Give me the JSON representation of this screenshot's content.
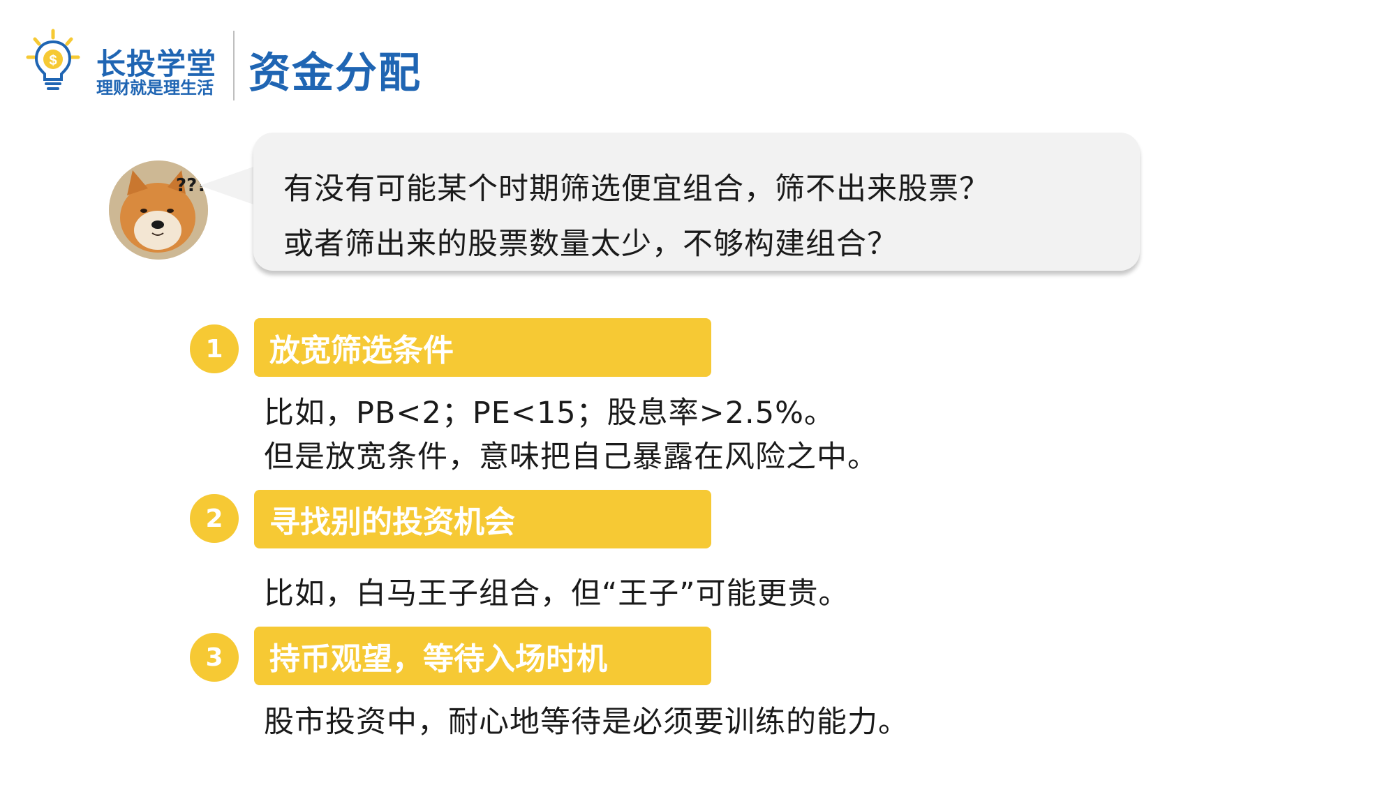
{
  "brand": {
    "name": "长投学堂",
    "slogan": "理财就是理生活",
    "logo_icon": "lightbulb-dollar-icon",
    "color": "#1f65b3"
  },
  "page": {
    "title": "资金分配"
  },
  "question": {
    "avatar_icon": "confused-shiba-dog-avatar",
    "avatar_marks": "???",
    "line1": "有没有可能某个时期筛选便宜组合，筛不出来股票？",
    "line2": "或者筛出来的股票数量太少，不够构建组合？"
  },
  "options": [
    {
      "number": "1",
      "title": "放宽筛选条件",
      "lines": [
        "比如，PB<2；PE<15；股息率>2.5%。",
        "但是放宽条件，意味把自己暴露在风险之中。"
      ]
    },
    {
      "number": "2",
      "title": "寻找别的投资机会",
      "lines": [
        "比如，白马王子组合，但“王子”可能更贵。"
      ]
    },
    {
      "number": "3",
      "title": "持币观望，等待入场时机",
      "lines": [
        "股市投资中，耐心地等待是必须要训练的能力。"
      ]
    }
  ],
  "colors": {
    "accent_yellow": "#f6c934",
    "bubble_bg": "#f2f2f2",
    "text": "#1a1a1a"
  }
}
